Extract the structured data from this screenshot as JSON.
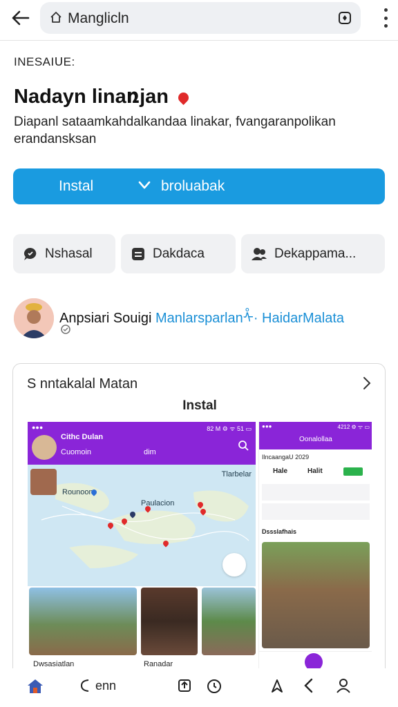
{
  "topbar": {
    "back_icon": "arrow-left-icon",
    "url": "Manglicln",
    "home_icon": "home-icon",
    "tabs_icon": "tabs-icon",
    "menu_icon": "kebab-icon"
  },
  "app": {
    "eyebrow": "INESAIᑌE:",
    "title": "Nadayn linaռjan",
    "description": "Diapanl sataamkahdalkandaa linakar, fvangaranpolikan erandansksan",
    "install_label": "Instal",
    "secondary_label": "broluabak",
    "accent": "#1a9be0",
    "pin_color": "#e02a2a"
  },
  "chips": [
    {
      "label": "Nshasal",
      "icon": "chat-bubble-icon"
    },
    {
      "label": "Dakdaca",
      "icon": "document-icon"
    },
    {
      "label": "Dekappama...",
      "icon": "people-icon"
    }
  ],
  "developer": {
    "name": "Anpsiari Souigi",
    "link": "Manlarsparlanᢥ· HaidarMalata"
  },
  "card": {
    "title": "S nntakalal Matan",
    "subtitle": "Instal",
    "shot1": {
      "status_left": "●●●",
      "status_right": "82 M  ⚙ ᯤ 51 ▭",
      "header_title": "Cithc Dulan",
      "header_sub": "Cuomoin",
      "header_sub2": "dim",
      "map_label_tr": "Tlarbelar",
      "map_label_1": "Rounoon",
      "map_label_2": "Paulacion",
      "footer_left": "Dwsasiatlan",
      "footer_mid": "Ranadar"
    },
    "shot2": {
      "status_left": "●●●",
      "status_right": "4212 ⚙ ᯤ ▭",
      "header_title": "Oonalollaa",
      "row_head": "Ilncaangaᑌ 2029",
      "tab1": "Hale",
      "tab2": "Halit",
      "section": "Dssslafhais"
    }
  },
  "bottomnav": {
    "home_icon": "home-icon",
    "back_label": "enn",
    "icons": [
      "share-box-icon",
      "timer-icon",
      "navigate-icon",
      "chevron-left-icon",
      "person-icon"
    ]
  }
}
